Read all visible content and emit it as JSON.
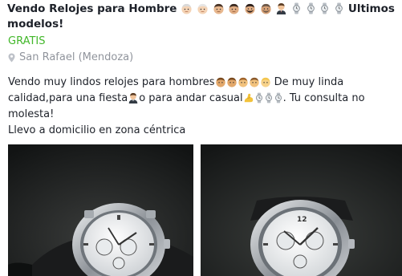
{
  "post": {
    "title_text": "Vendo Relojes para Hombre",
    "title_emojis": [
      "man-light-icon",
      "man-light-icon",
      "man-medium-icon",
      "man-medium-icon",
      "man-beard-icon",
      "man-beard-icon",
      "businessman-icon",
      "watch-icon",
      "watch-icon",
      "watch-icon",
      "watch-icon"
    ],
    "title_tail": "Ultimos modelos!",
    "price": "GRATIS",
    "location": "San Rafael (Mendoza)",
    "description": {
      "line1_a": "Vendo muy lindos relojes para hombres",
      "line1_emojis": [
        "man-medium-icon",
        "man-medium-icon",
        "man-light-icon",
        "man-light-icon",
        "man-blond-icon"
      ],
      "line1_b": " De muy linda calidad,para una fiesta",
      "line1_c": "o para andar casual",
      "line1_emojis2": [
        "flexed-arm-icon",
        "watch-icon",
        "watch-icon",
        "watch-icon"
      ],
      "line1_d": ". Tu consulta no molesta!",
      "line2": "Llevo a domicilio en zona céntrica"
    }
  },
  "photos": [
    {
      "name": "watch-photo-1"
    },
    {
      "name": "watch-photo-2"
    }
  ],
  "colors": {
    "price": "#42b72a",
    "location": "#90949c",
    "text": "#1d2129"
  }
}
